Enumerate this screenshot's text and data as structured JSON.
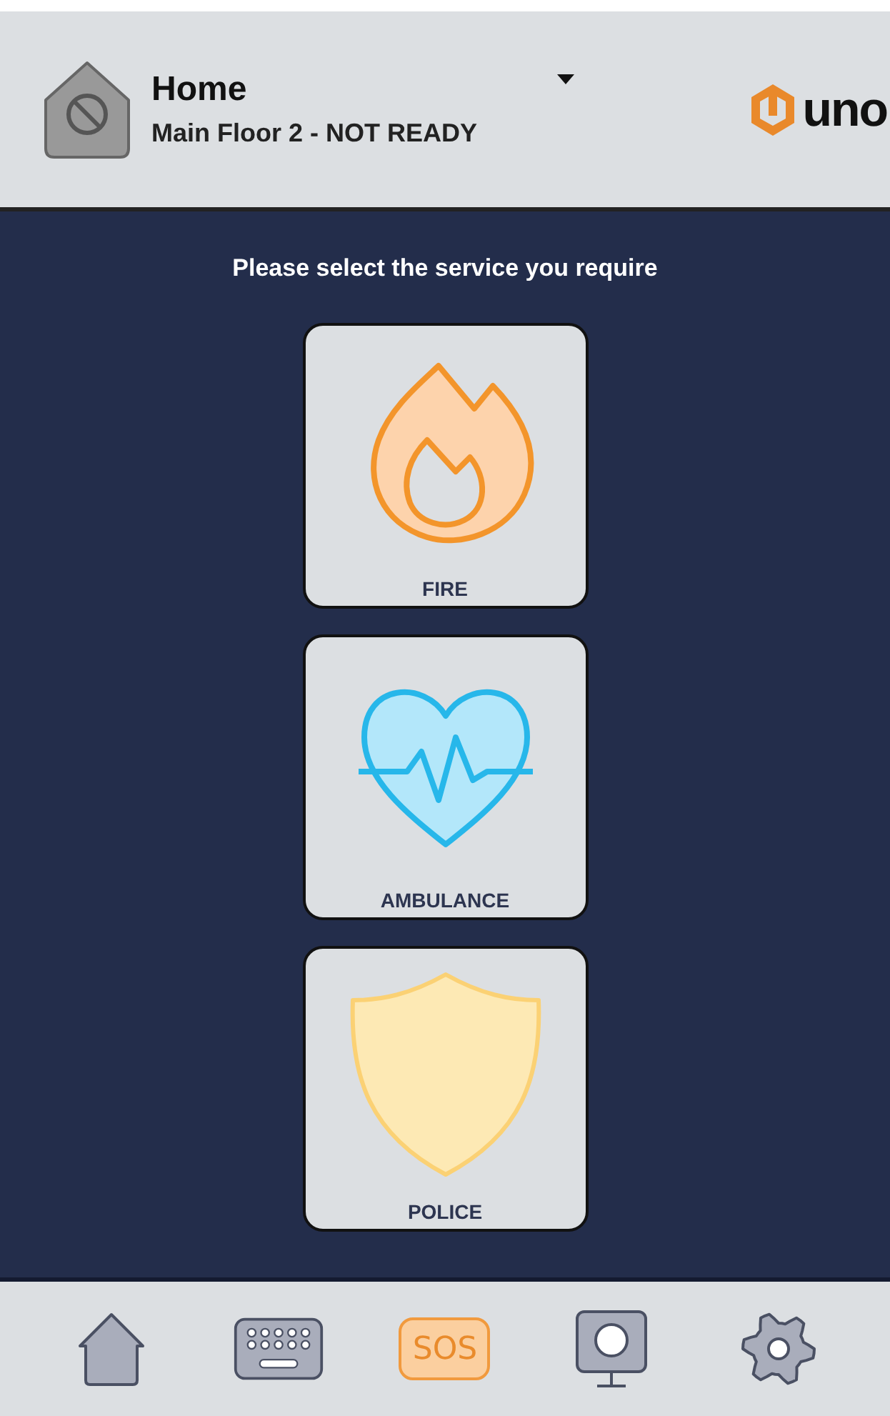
{
  "header": {
    "title": "Home",
    "subtitle": "Main Floor 2 - NOT READY",
    "logo_text": "uno"
  },
  "prompt": "Please select the service you require",
  "services": [
    {
      "kind": "fire",
      "label": "FIRE"
    },
    {
      "kind": "ambulance",
      "label": "AMBULANCE"
    },
    {
      "kind": "police",
      "label": "POLICE"
    }
  ],
  "nav": [
    {
      "kind": "home",
      "selected": false
    },
    {
      "kind": "keypad",
      "selected": false
    },
    {
      "kind": "sos",
      "label": "SOS",
      "selected": true
    },
    {
      "kind": "camera",
      "selected": false
    },
    {
      "kind": "settings",
      "selected": false
    }
  ]
}
